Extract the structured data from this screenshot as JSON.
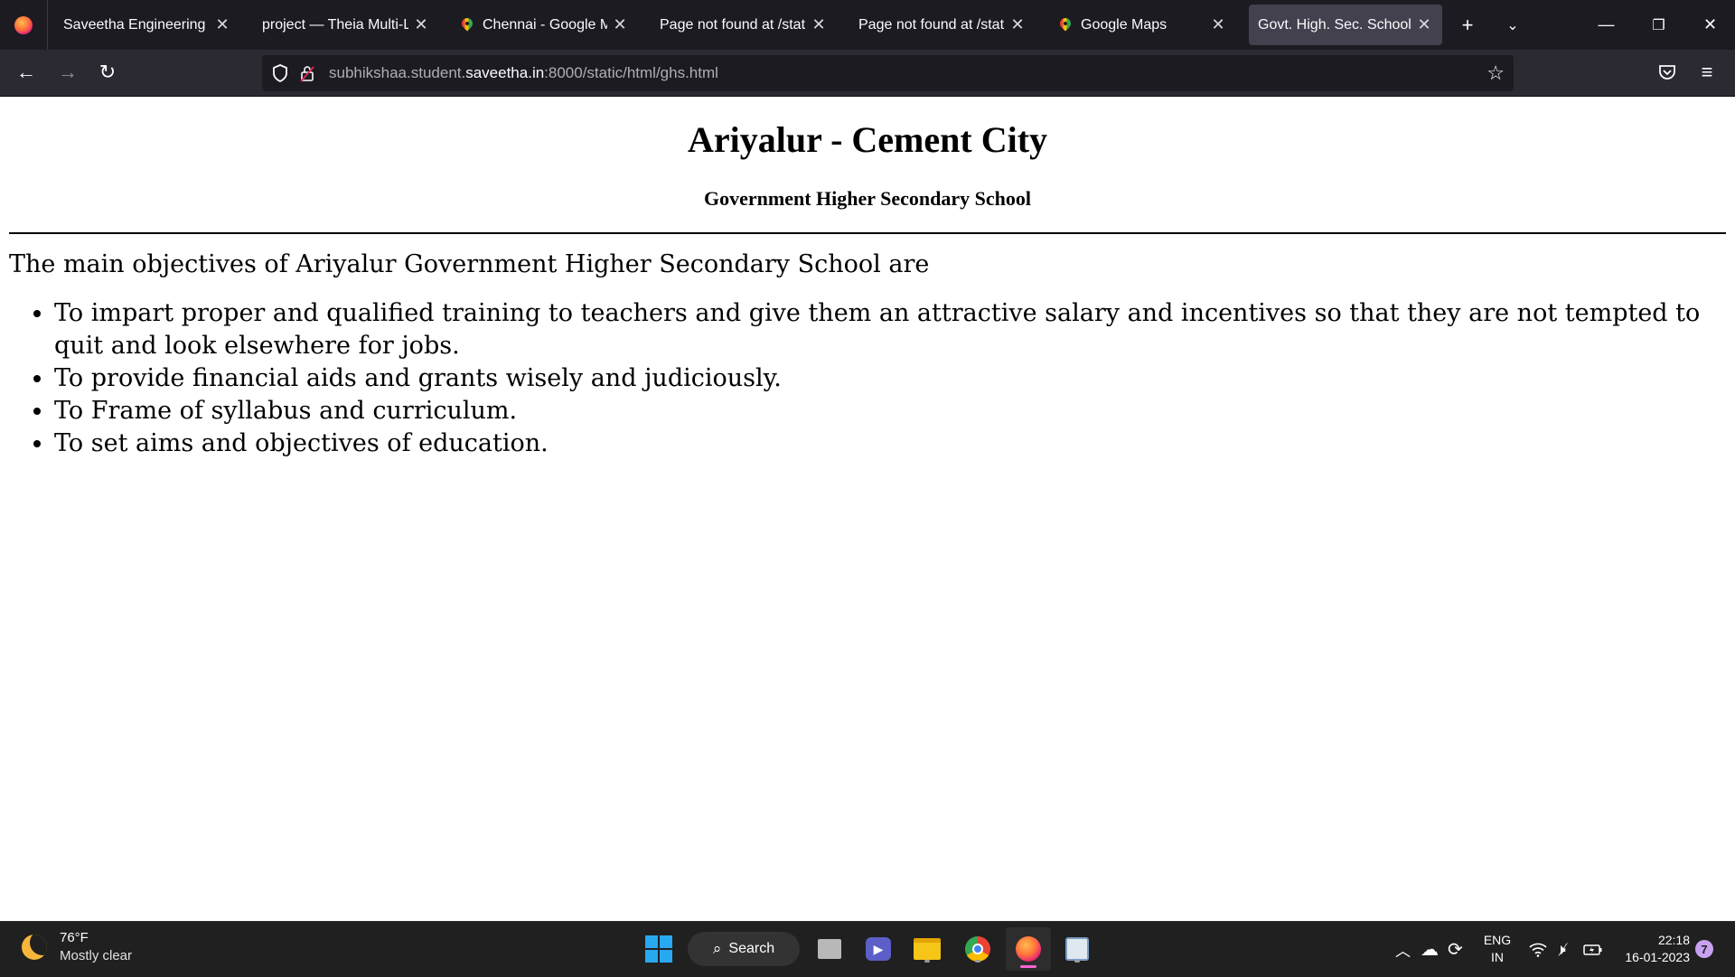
{
  "browser": {
    "tabs": [
      {
        "title": "Saveetha Engineering Colle",
        "favicon": "blank"
      },
      {
        "title": "project — Theia Multi-Lang",
        "favicon": "blank"
      },
      {
        "title": "Chennai - Google Maps",
        "favicon": "google-maps-pin"
      },
      {
        "title": "Page not found at /static/h",
        "favicon": "blank"
      },
      {
        "title": "Page not found at /static/h",
        "favicon": "blank"
      },
      {
        "title": "Google Maps",
        "favicon": "google-maps-pin"
      },
      {
        "title": "Govt. High. Sec. School",
        "favicon": "blank",
        "active": true
      }
    ],
    "url": {
      "prefix": "subhikshaa.student.",
      "host": "saveetha.in",
      "path": ":8000/static/html/ghs.html"
    }
  },
  "page": {
    "heading": "Ariyalur - Cement City",
    "subheading": "Government Higher Secondary School",
    "intro": "The main objectives of Ariyalur Government Higher Secondary School are",
    "objectives": [
      "To impart proper and qualified training to teachers and give them an attractive salary and incentives so that they are not tempted to quit and look elsewhere for jobs.",
      "To provide financial aids and grants wisely and judiciously.",
      "To Frame of syllabus and curriculum.",
      "To set aims and objectives of education."
    ]
  },
  "taskbar": {
    "weather": {
      "temp": "76°F",
      "condition": "Mostly clear"
    },
    "search_label": "Search",
    "language": {
      "line1": "ENG",
      "line2": "IN"
    },
    "clock": {
      "time": "22:18",
      "date": "16-01-2023"
    },
    "notification_count": "7"
  },
  "colors": {
    "tabbar_bg": "#1c1b22",
    "navbar_bg": "#2b2a33",
    "active_tab_bg": "#42414d",
    "taskbar_bg": "#202020",
    "accent": "#ff65d0"
  }
}
